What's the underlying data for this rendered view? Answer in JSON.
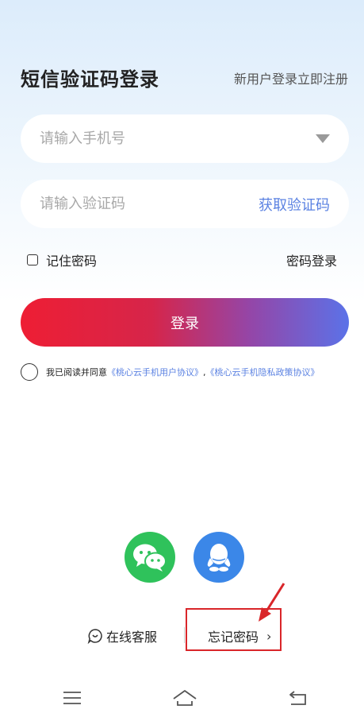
{
  "header": {
    "title": "短信验证码登录",
    "register_link": "新用户登录立即注册"
  },
  "form": {
    "phone_placeholder": "请输入手机号",
    "code_placeholder": "请输入验证码",
    "get_code": "获取验证码",
    "remember_password": "记住密码",
    "password_login": "密码登录",
    "login_button": "登录"
  },
  "agreement": {
    "prefix": "我已阅读并同意",
    "user_agreement": "《桃心云手机用户协议》",
    "separator": ",",
    "privacy_policy": "《桃心云手机隐私政策协议》"
  },
  "social": {
    "wechat": "wechat-icon",
    "qq": "qq-icon"
  },
  "footer": {
    "online_support": "在线客服",
    "forgot_password": "忘记密码",
    "chevron": "›"
  },
  "colors": {
    "accent": "#5b82e2",
    "wechat": "#2fc25b",
    "qq": "#3b87e8",
    "highlight": "#d9262a"
  }
}
